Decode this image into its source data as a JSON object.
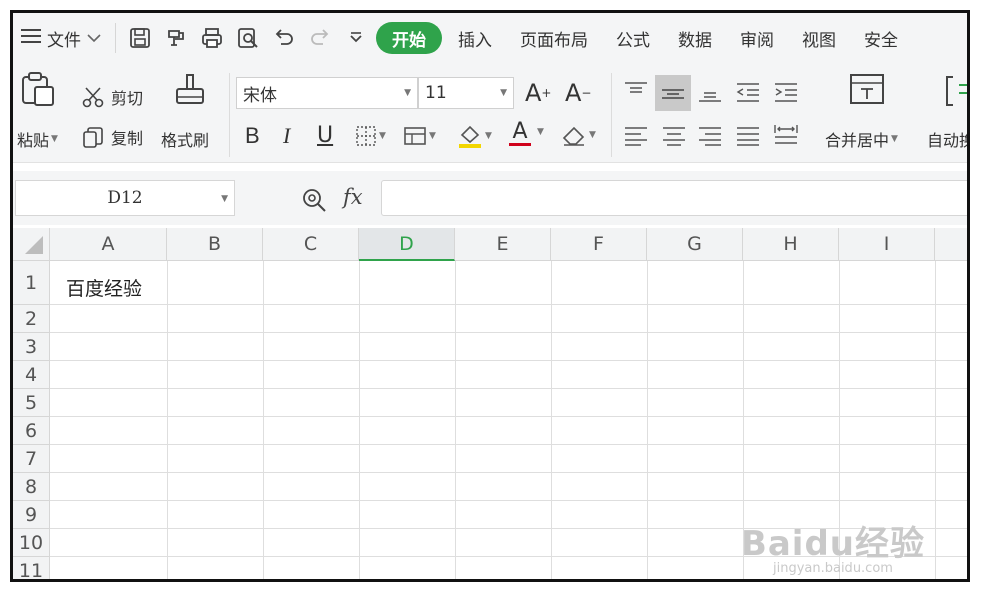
{
  "menubar": {
    "file_label": "文件",
    "tabs": [
      {
        "label": "开始",
        "active": true
      },
      {
        "label": "插入"
      },
      {
        "label": "页面布局"
      },
      {
        "label": "公式"
      },
      {
        "label": "数据"
      },
      {
        "label": "审阅"
      },
      {
        "label": "视图"
      },
      {
        "label": "安全"
      }
    ],
    "quick_icons": [
      "save-icon",
      "format-painter-quick-icon",
      "print-icon",
      "print-preview-icon",
      "undo-icon",
      "redo-icon",
      "more-icon"
    ],
    "accent": "#2fa34b"
  },
  "ribbon": {
    "paste_label": "粘贴",
    "cut_label": "剪切",
    "copy_label": "复制",
    "format_painter_label": "格式刷",
    "font_name": "宋体",
    "font_size": "11",
    "bold_label": "B",
    "italic_label": "I",
    "underline_label": "U",
    "font_color_label": "A",
    "grow_font_label": "A",
    "shrink_font_label": "A",
    "merge_center_label": "合并居中",
    "wrap_label": "自动换"
  },
  "formula_bar": {
    "name_box": "D12",
    "fx_label": "fx",
    "formula_value": ""
  },
  "sheet": {
    "columns": [
      "A",
      "B",
      "C",
      "D",
      "E",
      "F",
      "G",
      "H",
      "I"
    ],
    "selected_column": "D",
    "rows": [
      "1",
      "2",
      "3",
      "4",
      "5",
      "6",
      "7",
      "8",
      "9",
      "10",
      "11"
    ],
    "cells": {
      "A1": "百度经验"
    }
  },
  "watermark": {
    "main": "Baidu经验",
    "sub": "jingyan.baidu.com"
  }
}
